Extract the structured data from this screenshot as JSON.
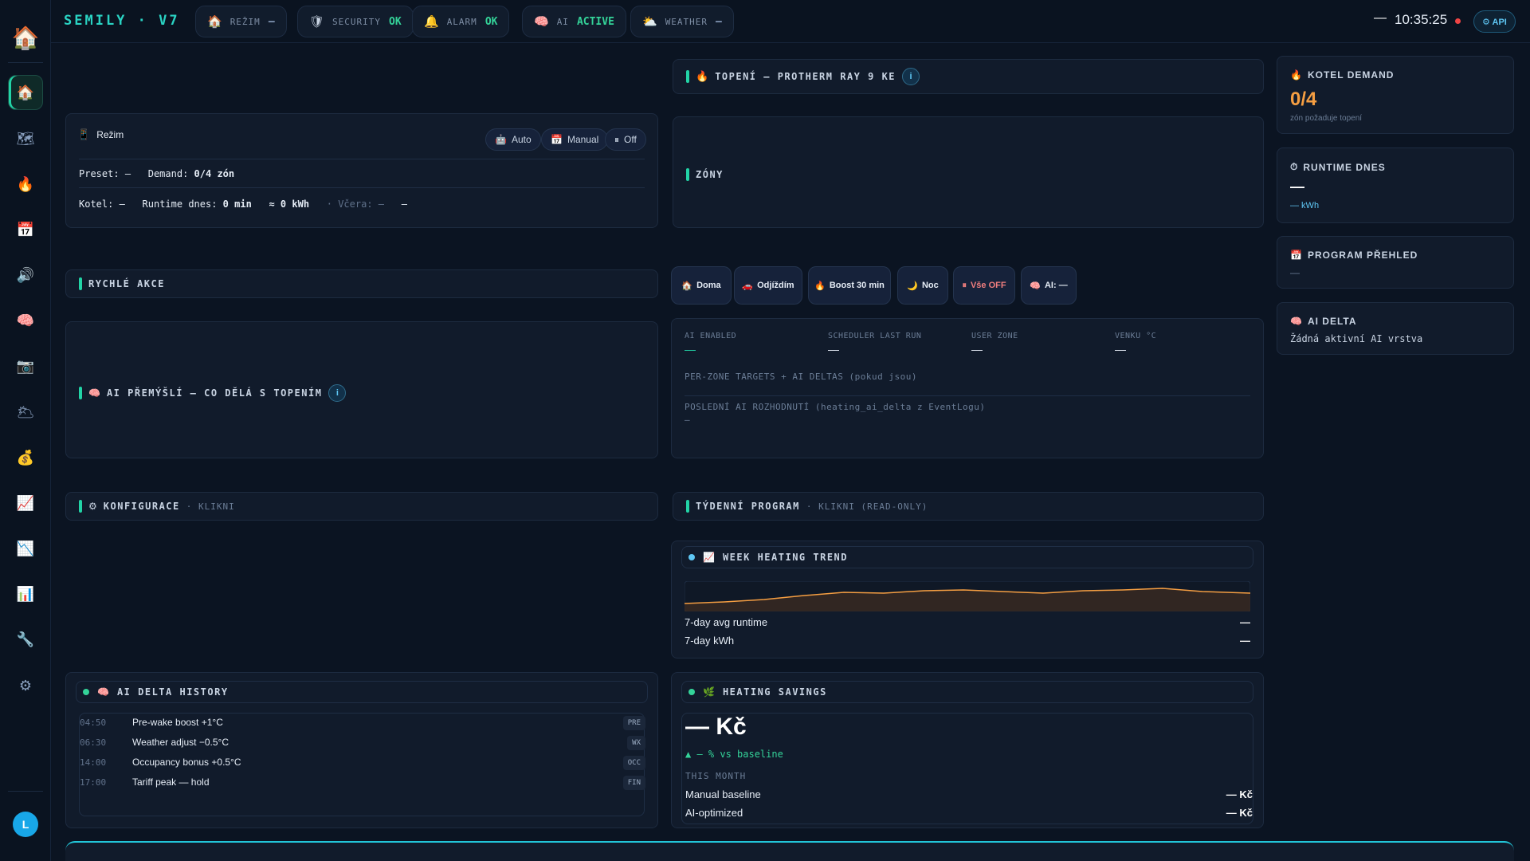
{
  "app": {
    "brand": "SEMILY · V7"
  },
  "topbar": {
    "pills": [
      {
        "icon": "🏠",
        "label": "REŽIM",
        "value": "—",
        "dim": true
      },
      {
        "icon": "🛡",
        "label": "SECURITY",
        "value": "OK",
        "dim": false
      },
      {
        "icon": "🔔",
        "label": "ALARM",
        "value": "OK",
        "dim": false
      },
      {
        "icon": "🧠",
        "label": "AI",
        "value": "ACTIVE",
        "dim": false
      },
      {
        "icon": "⛅",
        "label": "WEATHER",
        "value": "—",
        "dim": true
      }
    ],
    "dash": "—",
    "clock": "10:35:25",
    "api_label": "⚙ API"
  },
  "rail": {
    "logo": "🏠",
    "items": [
      {
        "icon": "🏠",
        "name": "home-icon"
      },
      {
        "icon": "🗺",
        "name": "map-icon"
      },
      {
        "icon": "🔥",
        "name": "fire-icon"
      },
      {
        "icon": "📅",
        "name": "calendar-icon"
      },
      {
        "icon": "🔊",
        "name": "speaker-icon"
      },
      {
        "icon": "🧠",
        "name": "brain-icon"
      },
      {
        "icon": "📷",
        "name": "camera-icon"
      },
      {
        "icon": "🌥",
        "name": "weather-icon"
      },
      {
        "icon": "💰",
        "name": "money-bag-icon"
      },
      {
        "icon": "📈",
        "name": "chart-up-icon"
      },
      {
        "icon": "📉",
        "name": "chart-down-icon"
      },
      {
        "icon": "📊",
        "name": "bar-chart-icon"
      },
      {
        "icon": "🔧",
        "name": "wrench-icon"
      },
      {
        "icon": "⚙",
        "name": "gear-icon"
      }
    ],
    "avatar": "L"
  },
  "mode_card": {
    "title": "Režim",
    "buttons": [
      {
        "icon": "🤖",
        "label": "Auto"
      },
      {
        "icon": "📅",
        "label": "Manual"
      },
      {
        "icon": "⏸",
        "label": "Off"
      }
    ],
    "preset_label": "Preset:",
    "preset_value": "—",
    "demand_label": "Demand:",
    "demand_value": "0/4 zón",
    "kotel_label": "Kotel:",
    "kotel_value": "—",
    "runtime_label": "Runtime dnes:",
    "runtime_value": "0 min",
    "kwh_value": "≈ 0 kWh",
    "vcera_label": "· Včera: —",
    "vcera_value": "—"
  },
  "sections": {
    "topeni": "TOPENÍ — PROTHERM RAY 9 KE",
    "zony": "ZÓNY",
    "rychle_akce": "RYCHLÉ AKCE",
    "ai_premysli": "AI PŘEMÝŠLÍ — CO DĚLÁ S TOPENÍM",
    "konfigurace": "KONFIGURACE",
    "konfigurace_sub": "· KLIKNI",
    "tydenni": "TÝDENNÍ PROGRAM",
    "tydenni_sub": "· KLIKNI (READ-ONLY)",
    "info": "i"
  },
  "quick_actions": [
    {
      "icon": "🏠",
      "label": "Doma",
      "red": false
    },
    {
      "icon": "🚗",
      "label": "Odjíždím",
      "red": false
    },
    {
      "icon": "🔥",
      "label": "Boost 30 min",
      "red": false
    },
    {
      "icon": "🌙",
      "label": "Noc",
      "red": false
    },
    {
      "icon": "⏸",
      "label": "Vše OFF",
      "red": true
    },
    {
      "icon": "🧠",
      "label": "AI: —",
      "red": false
    }
  ],
  "ai_state": {
    "cols": [
      {
        "label": "AI ENABLED",
        "value": "—"
      },
      {
        "label": "SCHEDULER LAST RUN",
        "value": "—"
      },
      {
        "label": "USER ZONE",
        "value": "—"
      },
      {
        "label": "VENKU °C",
        "value": "—"
      }
    ],
    "per_zone": "PER-ZONE TARGETS + AI DELTAS (pokud jsou)",
    "last_decision_label": "POSLEDNÍ AI ROZHODNUTÍ (heating_ai_delta z EventLogu)",
    "last_decision_value": "—"
  },
  "right_col": {
    "kotel_demand": {
      "icon": "🔥",
      "title": "KOTEL DEMAND",
      "value": "0/4",
      "sub": "zón požaduje topení"
    },
    "runtime": {
      "icon": "⏱",
      "title": "RUNTIME DNES",
      "value": "—",
      "sub": "— kWh"
    },
    "program": {
      "icon": "📅",
      "title": "PROGRAM PŘEHLED",
      "value": "—"
    },
    "ai_delta": {
      "icon": "🧠",
      "title": "AI DELTA",
      "value": "Žádná aktivní AI vrstva"
    }
  },
  "trend": {
    "title": "WEEK HEATING TREND",
    "icon": "📈",
    "rows": [
      {
        "label": "7-day avg runtime",
        "value": "—"
      },
      {
        "label": "7-day kWh",
        "value": "—"
      }
    ]
  },
  "ai_history": {
    "title": "AI DELTA HISTORY",
    "icon": "🧠",
    "rows": [
      {
        "time": "04:50",
        "text": "Pre-wake boost +1°C",
        "tag": "PRE"
      },
      {
        "time": "06:30",
        "text": "Weather adjust −0.5°C",
        "tag": "WX"
      },
      {
        "time": "14:00",
        "text": "Occupancy bonus +0.5°C",
        "tag": "OCC"
      },
      {
        "time": "17:00",
        "text": "Tariff peak — hold",
        "tag": "FIN"
      }
    ]
  },
  "savings": {
    "title": "HEATING SAVINGS",
    "icon": "🌿",
    "big": "— Kč",
    "pct": "▲ — % vs baseline",
    "period": "THIS MONTH",
    "rows": [
      {
        "label": "Manual baseline",
        "value": "— Kč"
      },
      {
        "label": "AI-optimized",
        "value": "— Kč"
      }
    ]
  },
  "colors": {
    "accent": "#22d3a6",
    "orange": "#f59e42",
    "ok": "#34d399",
    "info": "#5fc8f5"
  }
}
